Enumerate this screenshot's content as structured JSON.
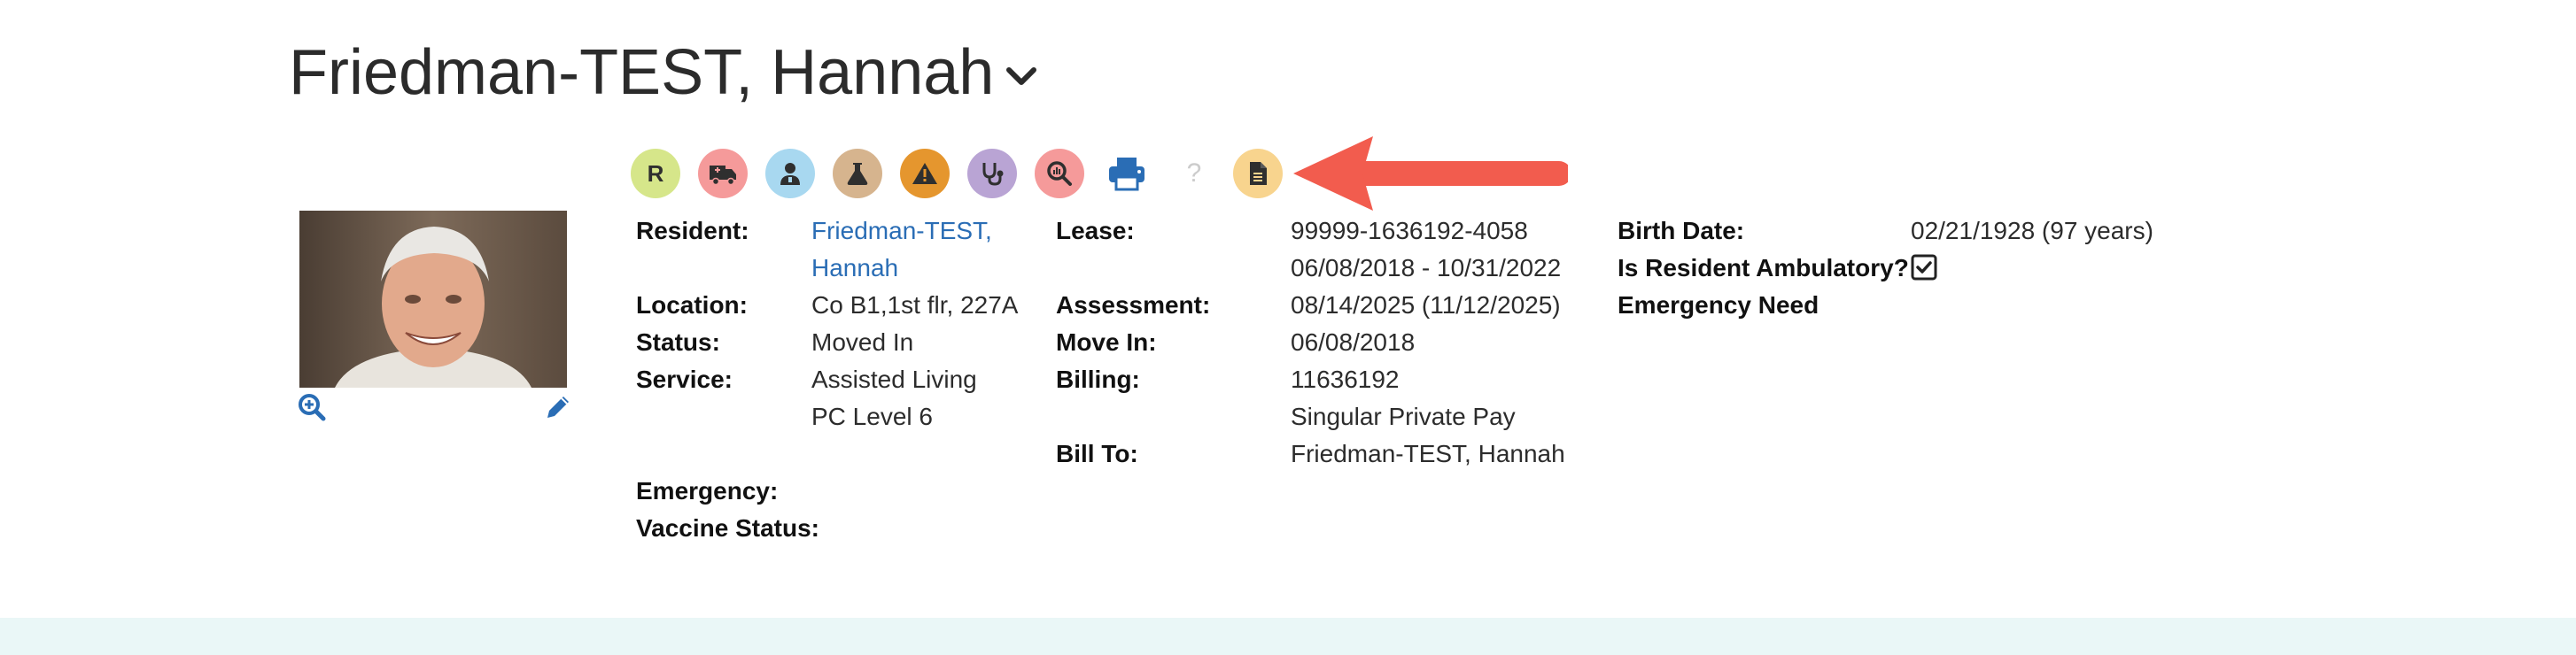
{
  "header": {
    "patient_name": "Friedman-TEST, Hannah"
  },
  "toolbar": {
    "icons": [
      {
        "name": "r-badge-icon",
        "letter": "R",
        "bg": "#d6e68a"
      },
      {
        "name": "ambulance-icon",
        "bg": "#f59a9a"
      },
      {
        "name": "doctor-icon",
        "bg": "#a8d8f0"
      },
      {
        "name": "flask-icon",
        "bg": "#d6b48e"
      },
      {
        "name": "warning-icon",
        "bg": "#e5962e"
      },
      {
        "name": "stethoscope-icon",
        "bg": "#b9a4d4"
      },
      {
        "name": "search-chart-icon",
        "bg": "#f59a9a"
      },
      {
        "name": "printer-icon",
        "color": "#2a6db5"
      },
      {
        "name": "help-icon",
        "glyph": "?",
        "color": "#cccccc"
      },
      {
        "name": "document-icon",
        "bg": "#f8d48e"
      }
    ],
    "arrow_color": "#f25c4e"
  },
  "resident": {
    "resident_label": "Resident:",
    "resident_name_line1": "Friedman-TEST,",
    "resident_name_line2": "Hannah",
    "location_label": "Location:",
    "location_value": "Co B1,1st flr, 227A",
    "status_label": "Status:",
    "status_value": "Moved In",
    "service_label": "Service:",
    "service_value_line1": "Assisted Living",
    "service_value_line2": "PC Level 6",
    "emergency_label": "Emergency:",
    "vaccine_label": "Vaccine Status:"
  },
  "lease": {
    "lease_label": "Lease:",
    "lease_number": "99999-1636192-4058",
    "lease_dates": "06/08/2018 - 10/31/2022",
    "assessment_label": "Assessment:",
    "assessment_value": "08/14/2025 (11/12/2025)",
    "move_in_label": "Move In:",
    "move_in_value": "06/08/2018",
    "billing_label": "Billing:",
    "billing_value_line1": "11636192",
    "billing_value_line2": "Singular Private Pay",
    "bill_to_label": "Bill To:",
    "bill_to_value": "Friedman-TEST, Hannah"
  },
  "personal": {
    "birth_date_label": "Birth Date:",
    "birth_date_value": "02/21/1928 (97 years)",
    "ambulatory_label": "Is Resident Ambulatory?",
    "ambulatory_checked": true,
    "emergency_need_label": "Emergency Need"
  },
  "colors": {
    "link": "#2a6db5",
    "bottom_band": "#eaf7f7"
  }
}
